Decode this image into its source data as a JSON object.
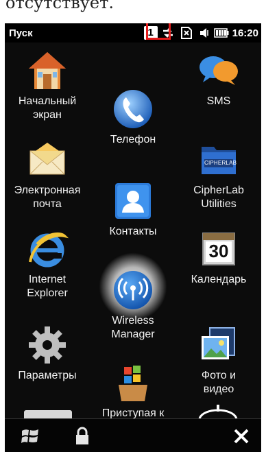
{
  "document": {
    "caption_fragment": "отсутствует."
  },
  "statusbar": {
    "title": "Пуск",
    "badge_number": "1",
    "time": "16:20"
  },
  "apps": [
    {
      "id": "home",
      "label": "Начальный\nэкран",
      "icon": "house-icon"
    },
    {
      "id": "phone",
      "label": "Телефон",
      "icon": "phone-handset-icon"
    },
    {
      "id": "sms",
      "label": "SMS",
      "icon": "chat-bubbles-icon"
    },
    {
      "id": "email",
      "label": "Электронная\nпочта",
      "icon": "envelope-icon"
    },
    {
      "id": "contacts",
      "label": "Контакты",
      "icon": "contact-card-icon"
    },
    {
      "id": "cipherlab",
      "label": "CipherLab\nUtilities",
      "icon": "folder-icon"
    },
    {
      "id": "ie",
      "label": "Internet\nExplorer",
      "icon": "internet-explorer-icon"
    },
    {
      "id": "wireless",
      "label": "Wireless\nManager",
      "icon": "wireless-antenna-icon"
    },
    {
      "id": "calendar",
      "label": "Календарь",
      "icon": "calendar-icon"
    },
    {
      "id": "settings",
      "label": "Параметры",
      "icon": "gear-icon"
    },
    {
      "id": "getstarted",
      "label": "Приступая к",
      "icon": "windows-box-icon"
    },
    {
      "id": "photos",
      "label": "Фото и\nвидео",
      "icon": "photo-film-icon"
    }
  ],
  "folder_label": "CIPHERLAB",
  "calendar_day": "30",
  "colors": {
    "highlight_box": "#e61c1c",
    "phone_bg": "#0c0c0c"
  }
}
